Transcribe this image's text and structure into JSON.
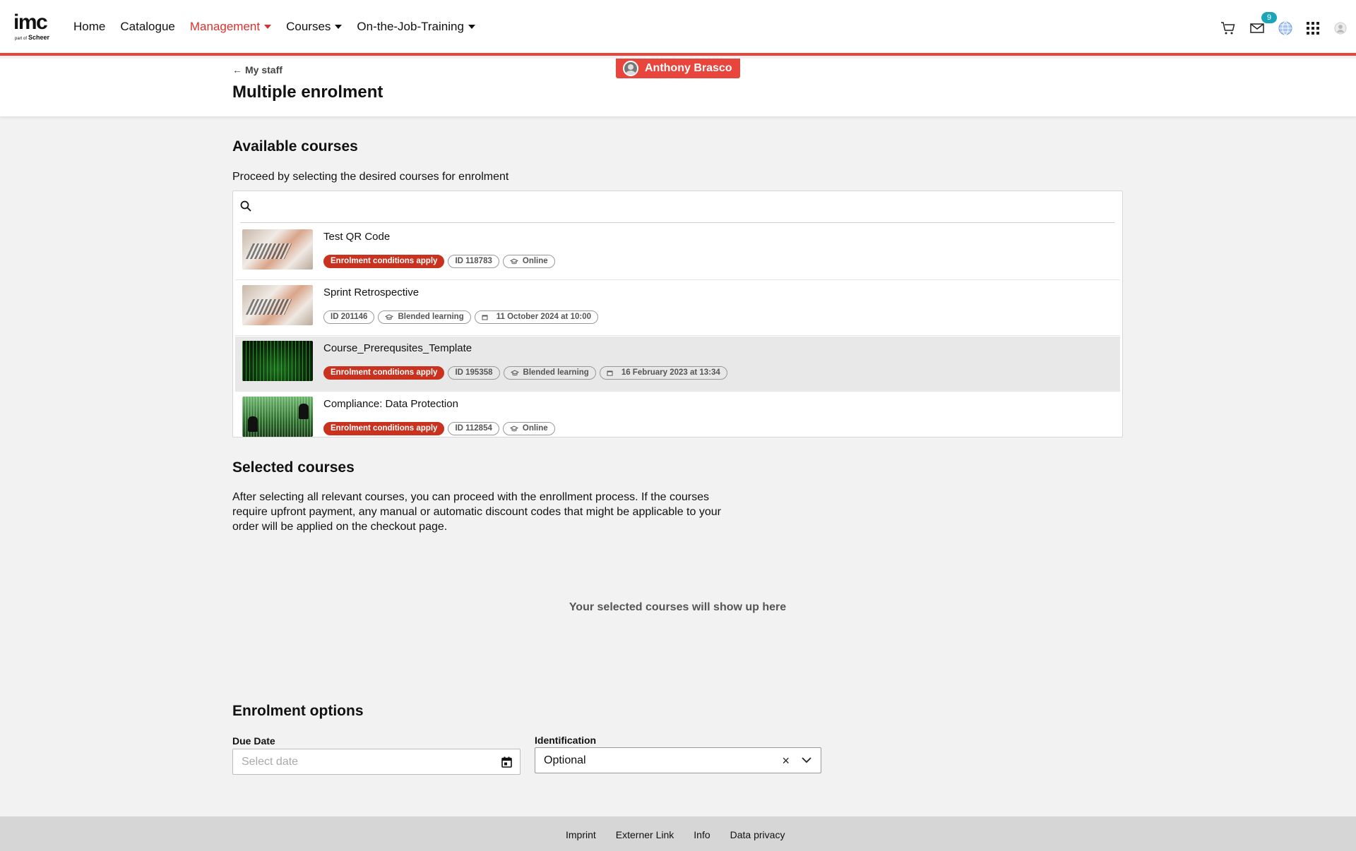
{
  "header": {
    "logo_text": "imc",
    "logo_part_of": "part of",
    "logo_brand": "Scheer",
    "nav": [
      {
        "label": "Home"
      },
      {
        "label": "Catalogue"
      },
      {
        "label": "Management",
        "active": true,
        "dropdown": true
      },
      {
        "label": "Courses",
        "dropdown": true
      },
      {
        "label": "On-the-Job-Training",
        "dropdown": true
      }
    ],
    "icons": [
      "cart-icon",
      "mail-icon",
      "globe-icon",
      "apps-grid-icon",
      "user-avatar-icon"
    ],
    "mail_badge": "9"
  },
  "subheader": {
    "back_label": "My staff",
    "title": "Multiple enrolment",
    "impersonated_user": "Anthony Brasco"
  },
  "available": {
    "heading": "Available courses",
    "description": "Proceed by selecting the desired courses for enrolment",
    "courses": [
      {
        "title": "Test QR Code",
        "tags": [
          "Enrolment conditions apply",
          "ID 118783",
          "Online"
        ]
      },
      {
        "title": "Sprint Retrospective",
        "tags": [
          "ID 201146",
          "Blended learning",
          "11 October 2024 at 10:00"
        ]
      },
      {
        "title": "Course_Prerequsites_Template",
        "tags": [
          "Enrolment conditions apply",
          "ID 195358",
          "Blended learning",
          "16 February 2023 at 13:34"
        ]
      },
      {
        "title": "Compliance: Data Protection",
        "tags": [
          "Enrolment conditions apply",
          "ID 112854",
          "Online"
        ]
      }
    ]
  },
  "selected": {
    "heading": "Selected courses",
    "description": "After selecting all relevant courses, you can proceed with the enrollment process. If the courses require upfront payment, any manual or automatic discount codes that might be applicable to your order will be applied on the checkout page.",
    "empty_text": "Your selected courses will show up here"
  },
  "options": {
    "heading": "Enrolment options",
    "due_date_label": "Due Date",
    "due_date_placeholder": "Select date",
    "identification_label": "Identification",
    "identification_value": "Optional"
  },
  "footer": {
    "links": [
      "Imprint",
      "Externer Link",
      "Info",
      "Data privacy"
    ]
  },
  "colors": {
    "accent": "#e8453c",
    "condition_tag": "#c8321e",
    "badge": "#1aa5b8"
  }
}
